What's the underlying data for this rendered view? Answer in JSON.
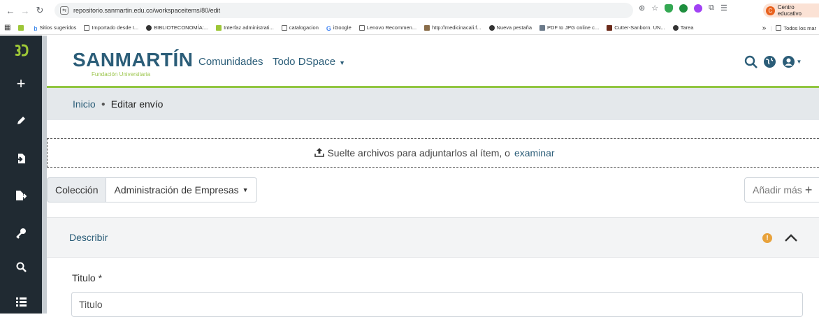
{
  "browser": {
    "url": "repositorio.sanmartin.edu.co/workspaceitems/80/edit",
    "profile_label": "Centro educativo",
    "profile_initial": "C",
    "bookmarks": [
      "Sitios sugeridos",
      "Importado desde I...",
      "BIBLIOTECONOMÍA:...",
      "Interfaz administrati...",
      "catalogacion",
      "iGoogle",
      "Lenovo Recommen...",
      "http://medicinacali.f...",
      "Nueva pestaña",
      "PDF to JPG online c...",
      "Cutter-Sanborn. UN...",
      "Tarea"
    ],
    "bookmarks_overflow": "»",
    "all_bookmarks": "Todos los mar"
  },
  "header": {
    "brand": "SANMARTÍN",
    "brand_sub": "Fundación Universitaria",
    "nav_communities": "Comunidades",
    "nav_all": "Todo DSpace"
  },
  "breadcrumb": {
    "home": "Inicio",
    "current": "Editar envío"
  },
  "upload": {
    "text": "Suelte archivos para adjuntarlos al ítem, o",
    "link": "examinar"
  },
  "collection": {
    "label": "Colección",
    "value": "Administración de Empresas"
  },
  "add_more": "Añadir más",
  "section": {
    "title": "Describir",
    "warning": "!"
  },
  "form": {
    "title_label": "Titulo *",
    "title_placeholder": "Titulo"
  },
  "colors": {
    "brand": "#2b5d78",
    "accent": "#92c642",
    "sidebar": "#202a32",
    "warning": "#e8a23b"
  }
}
